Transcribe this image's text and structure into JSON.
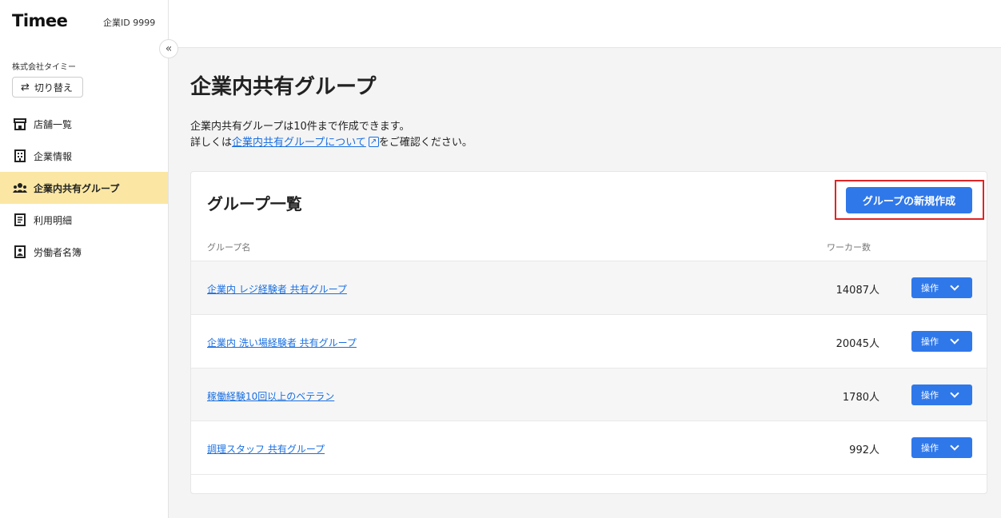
{
  "sidebar": {
    "brand": "Timee",
    "company_id": "企業ID 9999",
    "collapse_icon": "double-chevron-left-icon",
    "company_name": "株式会社タイミー",
    "switch_label": "切り替え",
    "items": [
      {
        "label": "店舗一覧",
        "icon": "store-icon",
        "active": false
      },
      {
        "label": "企業情報",
        "icon": "building-icon",
        "active": false
      },
      {
        "label": "企業内共有グループ",
        "icon": "group-icon",
        "active": true
      },
      {
        "label": "利用明細",
        "icon": "receipt-icon",
        "active": false
      },
      {
        "label": "労働者名簿",
        "icon": "contact-card-icon",
        "active": false
      }
    ]
  },
  "main": {
    "title": "企業内共有グループ",
    "desc_line1": "企業内共有グループは10件まで作成できます。",
    "desc_prefix": "詳しくは",
    "desc_link": "企業内共有グループについて",
    "desc_suffix": "をご確認ください。"
  },
  "card": {
    "title": "グループ一覧",
    "create_button": "グループの新規作成",
    "col_name": "グループ名",
    "col_count": "ワーカー数",
    "action_label": "操作",
    "rows": [
      {
        "name": "企業内 レジ経験者 共有グループ",
        "count": "14087人"
      },
      {
        "name": "企業内 洗い場経験者 共有グループ",
        "count": "20045人"
      },
      {
        "name": "稼働経験10回以上のベテラン",
        "count": "1780人"
      },
      {
        "name": "調理スタッフ 共有グループ",
        "count": "992人"
      }
    ]
  },
  "colors": {
    "accent": "#2f78ea",
    "active_nav": "#fbe7a3",
    "highlight": "#e02424",
    "link": "#1a6fe0"
  }
}
